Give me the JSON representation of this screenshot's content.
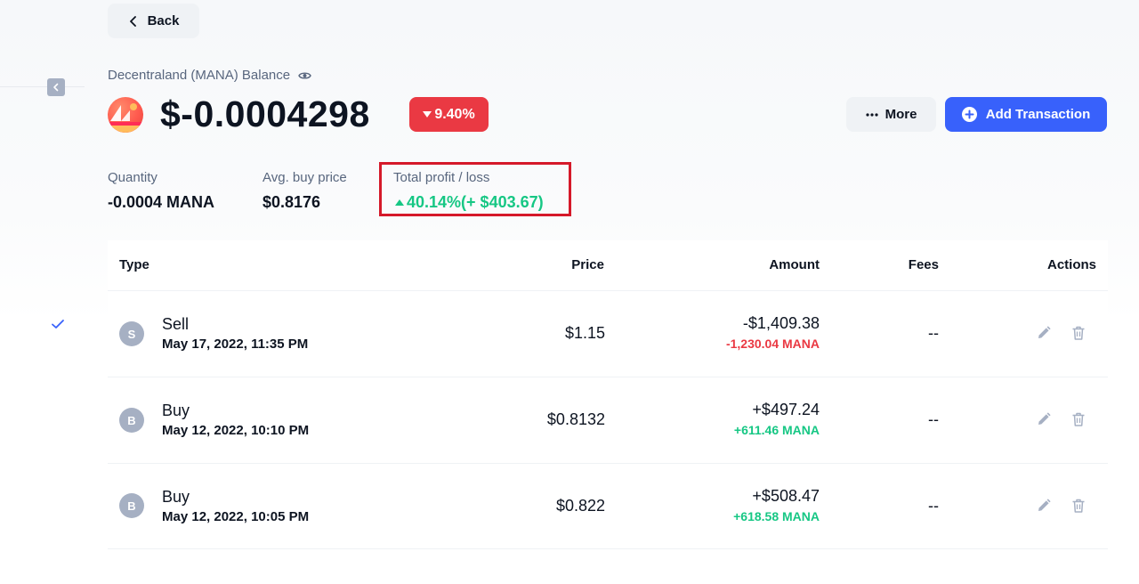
{
  "nav": {
    "back_label": "Back"
  },
  "header": {
    "balance_label": "Decentraland (MANA) Balance",
    "balance_value": "$-0.0004298",
    "change_percent": "9.40%",
    "more_label": "More",
    "add_transaction_label": "Add Transaction"
  },
  "stats": {
    "quantity_label": "Quantity",
    "quantity_value": "-0.0004 MANA",
    "avg_price_label": "Avg. buy price",
    "avg_price_value": "$0.8176",
    "pl_label": "Total profit / loss",
    "pl_value": "40.14%(+ $403.67)"
  },
  "table": {
    "headers": {
      "type": "Type",
      "price": "Price",
      "amount": "Amount",
      "fees": "Fees",
      "actions": "Actions"
    },
    "rows": [
      {
        "avatar": "S",
        "type": "Sell",
        "date": "May 17, 2022, 11:35 PM",
        "price": "$1.15",
        "amount": "-$1,409.38",
        "coins": "-1,230.04 MANA",
        "fees": "--"
      },
      {
        "avatar": "B",
        "type": "Buy",
        "date": "May 12, 2022, 10:10 PM",
        "price": "$0.8132",
        "amount": "+$497.24",
        "coins": "+611.46 MANA",
        "fees": "--"
      },
      {
        "avatar": "B",
        "type": "Buy",
        "date": "May 12, 2022, 10:05 PM",
        "price": "$0.822",
        "amount": "+$508.47",
        "coins": "+618.58 MANA",
        "fees": "--"
      }
    ]
  },
  "colors": {
    "accent": "#3861fb",
    "negative": "#ea3943",
    "positive": "#16c784",
    "highlight_box": "#d5192a",
    "muted": "#58667e"
  },
  "icons": {
    "back": "chevron-left-icon",
    "collapse": "chevron-left-icon",
    "visibility": "eye-icon",
    "change": "caret-down-icon",
    "more": "ellipsis-icon",
    "add": "plus-circle-icon",
    "profit": "caret-up-icon",
    "row_selected": "check-icon",
    "edit": "pencil-icon",
    "delete": "trash-icon"
  }
}
